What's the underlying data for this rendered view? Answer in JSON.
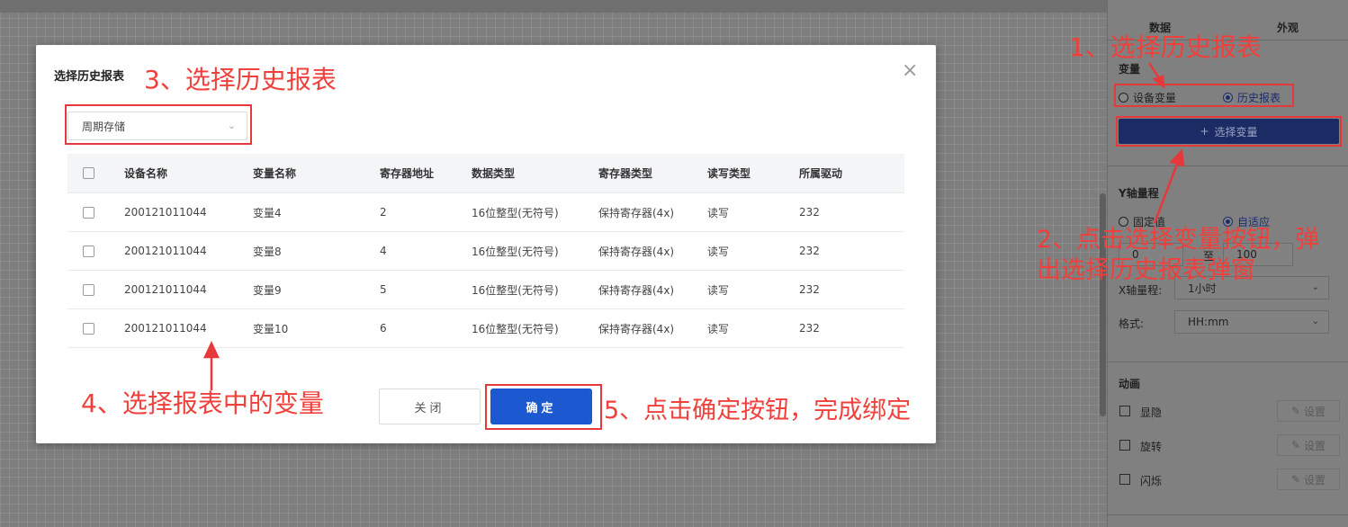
{
  "modal": {
    "title": "选择历史报表",
    "close_icon": "close-icon",
    "storage_select": {
      "value": "周期存储"
    },
    "table": {
      "columns": [
        "设备名称",
        "变量名称",
        "寄存器地址",
        "数据类型",
        "寄存器类型",
        "读写类型",
        "所属驱动"
      ],
      "rows": [
        [
          "200121011044",
          "变量4",
          "2",
          "16位整型(无符号)",
          "保持寄存器(4x)",
          "读写",
          "232"
        ],
        [
          "200121011044",
          "变量8",
          "4",
          "16位整型(无符号)",
          "保持寄存器(4x)",
          "读写",
          "232"
        ],
        [
          "200121011044",
          "变量9",
          "5",
          "16位整型(无符号)",
          "保持寄存器(4x)",
          "读写",
          "232"
        ],
        [
          "200121011044",
          "变量10",
          "6",
          "16位整型(无符号)",
          "保持寄存器(4x)",
          "读写",
          "232"
        ]
      ]
    },
    "close_label": "关闭",
    "confirm_label": "确定"
  },
  "panel": {
    "tab_data": "数据",
    "tab_appearance": "外观",
    "variable_section": "变量",
    "radio_device_var": "设备变量",
    "radio_history_report": "历史报表",
    "select_var_button": "选择变量",
    "y_axis_section": "Y轴量程",
    "radio_fixed": "固定值",
    "radio_auto": "自适应",
    "range_min": "0",
    "range_to": "至",
    "range_max": "100",
    "x_axis_label": "X轴量程:",
    "x_axis_value": "1小时",
    "format_label": "格式:",
    "format_value": "HH:mm",
    "animation_section": "动画",
    "anim_items": [
      "显隐",
      "旋转",
      "闪烁"
    ],
    "set_label": "设置"
  },
  "annotations": {
    "step1": "1、选择历史报表",
    "step2": "2、点击选择变量按钮，弹出选择历史报表弹窗",
    "step3": "3、选择历史报表",
    "step4": "4、选择报表中的变量",
    "step5": "5、点击确定按钮，完成绑定",
    "color": "#f0403c"
  }
}
